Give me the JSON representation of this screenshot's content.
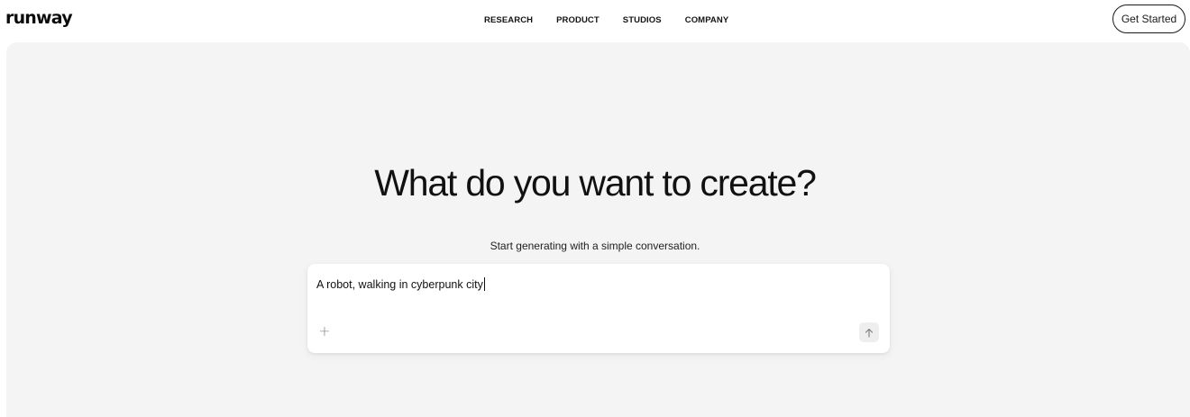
{
  "brand": {
    "logo_text": "runway"
  },
  "nav": {
    "items": [
      {
        "label": "RESEARCH"
      },
      {
        "label": "PRODUCT"
      },
      {
        "label": "STUDIOS"
      },
      {
        "label": "COMPANY"
      }
    ],
    "cta_label": "Get Started"
  },
  "hero": {
    "headline": "What do you want to create?",
    "subline": "Start generating with a simple conversation."
  },
  "prompt": {
    "value": "A robot, walking in cyberpunk city",
    "add_icon": "plus-icon",
    "send_icon": "arrow-up-icon"
  },
  "colors": {
    "background": "#ffffff",
    "hero_background": "#f4f4f4",
    "text": "#111111",
    "muted_icon": "#8a8a8a",
    "send_button_bg": "#eeeeee"
  }
}
